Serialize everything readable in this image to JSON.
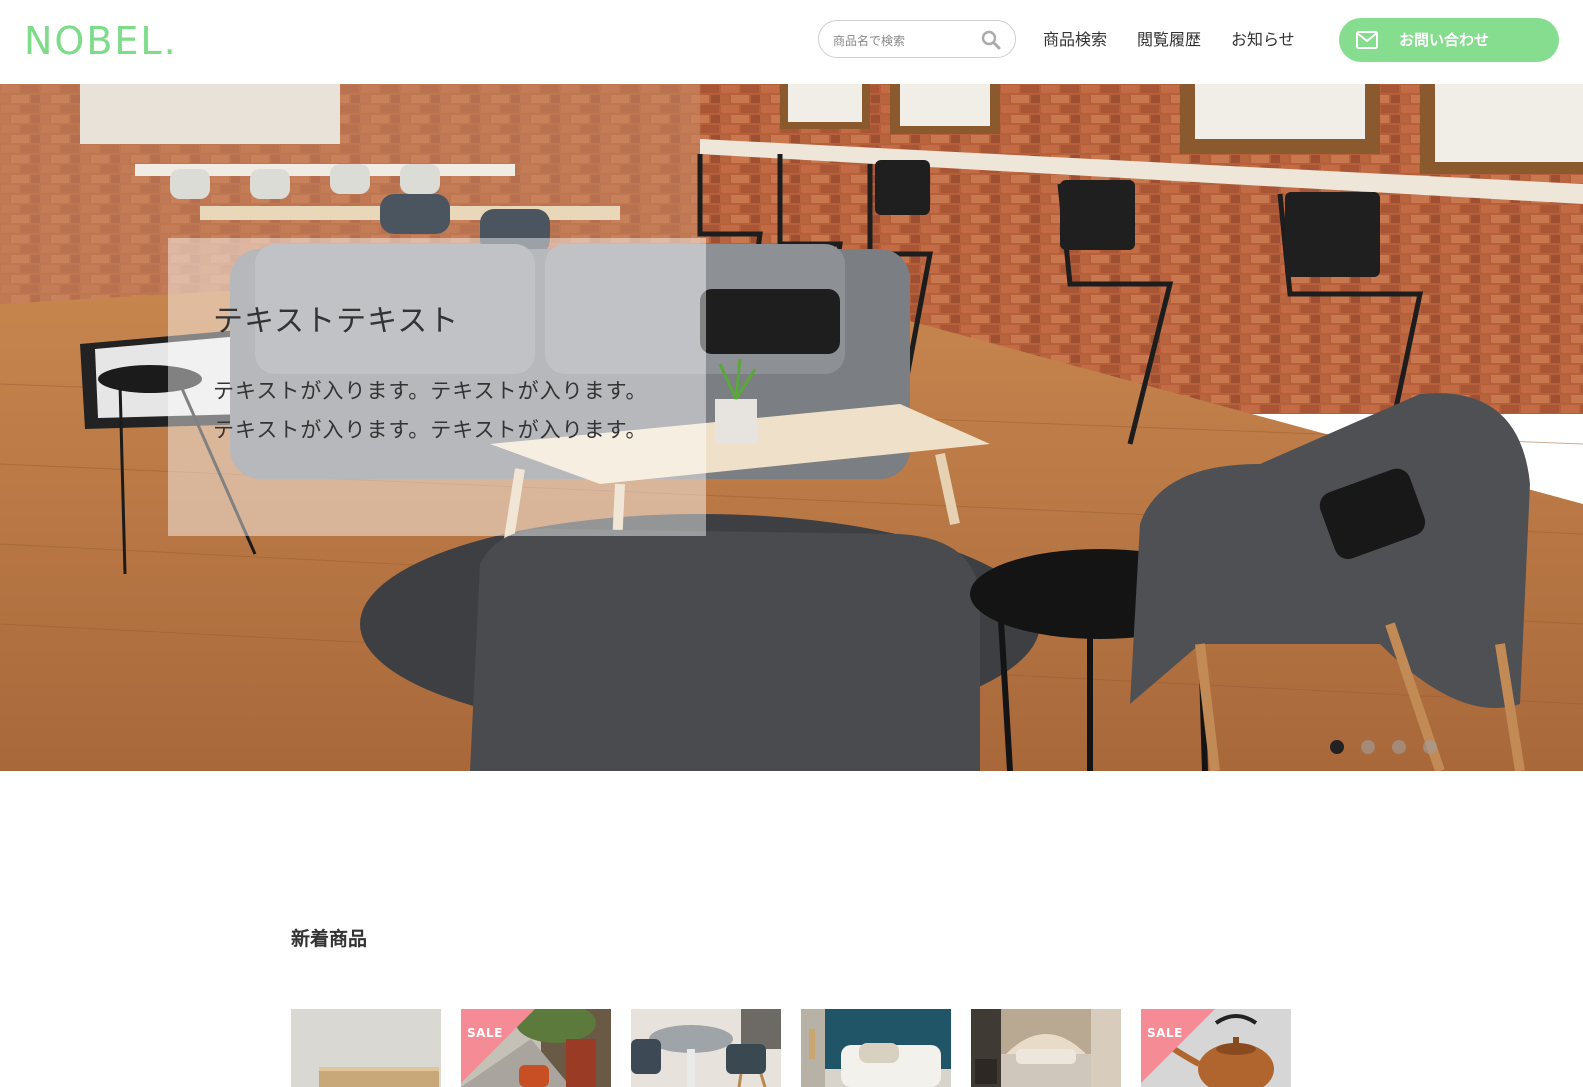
{
  "header": {
    "logo": "NOBEL.",
    "search_placeholder": "商品名で検索",
    "nav": [
      "商品検索",
      "閲覧履歴",
      "お知らせ"
    ],
    "contact_label": "お問い合わせ"
  },
  "hero": {
    "title": "テキストテキスト",
    "text_line1": "テキストが入ります。テキストが入ります。",
    "text_line2": "テキストが入ります。テキストが入ります。",
    "slide_count": 4,
    "active_slide": 1
  },
  "new_arrivals": {
    "title": "新着商品",
    "items": [
      {
        "sale": false,
        "subject": "wooden-table"
      },
      {
        "sale": true,
        "sale_label": "SALE",
        "subject": "orange-armchair-street"
      },
      {
        "sale": false,
        "subject": "round-table-chairs"
      },
      {
        "sale": false,
        "subject": "teal-headboard-bed"
      },
      {
        "sale": false,
        "subject": "tufted-bed"
      },
      {
        "sale": true,
        "sale_label": "SALE",
        "subject": "copper-kettle"
      }
    ]
  },
  "colors": {
    "brand_green": "#7ddc8a",
    "button_green": "#86dc8f",
    "sale_pink": "#f58b95"
  }
}
